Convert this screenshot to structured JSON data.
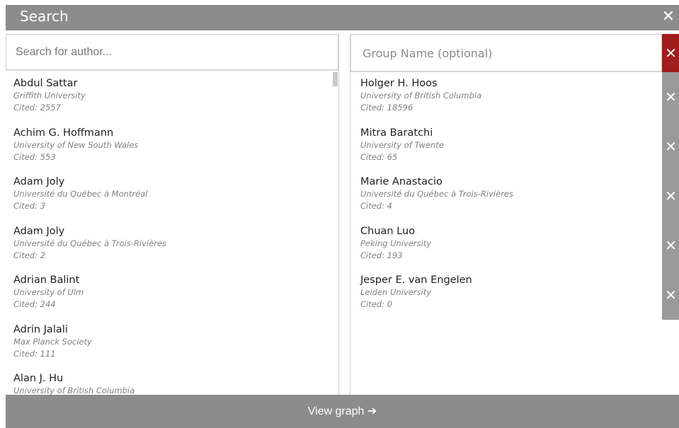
{
  "header": {
    "title": "Search",
    "close_glyph": "✕"
  },
  "search": {
    "placeholder": "Search for author..."
  },
  "results": [
    {
      "name": "Abdul Sattar",
      "affiliation": "Griffith University",
      "cited": "Cited: 2557"
    },
    {
      "name": "Achim G. Hoffmann",
      "affiliation": "University of New South Wales",
      "cited": "Cited: 553"
    },
    {
      "name": "Adam Joly",
      "affiliation": "Université du Québec à Montréal",
      "cited": "Cited: 3"
    },
    {
      "name": "Adam Joly",
      "affiliation": "Université du Québec à Trois-Rivières",
      "cited": "Cited: 2"
    },
    {
      "name": "Adrian Balint",
      "affiliation": "University of Ulm",
      "cited": "Cited: 244"
    },
    {
      "name": "Adrin Jalali",
      "affiliation": "Max Planck Society",
      "cited": "Cited: 111"
    },
    {
      "name": "Alan J. Hu",
      "affiliation": "University of British Columbia",
      "cited": ""
    }
  ],
  "group": {
    "placeholder": "Group Name (optional)",
    "clear_glyph": "✕"
  },
  "selected": [
    {
      "name": "Holger H. Hoos",
      "affiliation": "University of British Columbia",
      "cited": "Cited: 18596"
    },
    {
      "name": "Mitra Baratchi",
      "affiliation": "University of Twente",
      "cited": "Cited: 65"
    },
    {
      "name": "Marie Anastacio",
      "affiliation": "Université du Québec à Trois-Rivières",
      "cited": "Cited: 4"
    },
    {
      "name": "Chuan Luo",
      "affiliation": "Peking University",
      "cited": "Cited: 193"
    },
    {
      "name": "Jesper E. van Engelen",
      "affiliation": "Leiden University",
      "cited": "Cited: 0"
    }
  ],
  "remove_glyph": "✕",
  "footer": {
    "label": "View graph ➔"
  },
  "colors": {
    "bar": "#8c8c8c",
    "danger": "#a11c1c",
    "remove_col": "#9a9a9a"
  }
}
